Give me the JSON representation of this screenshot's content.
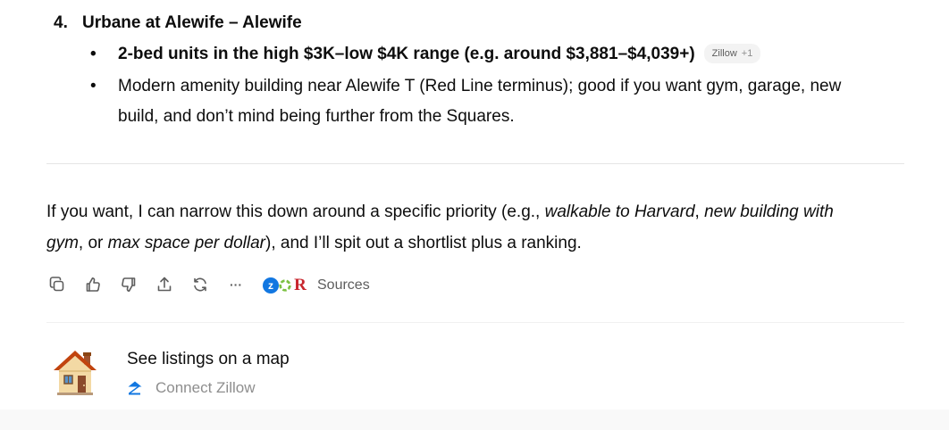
{
  "item": {
    "number": "4.",
    "title": "Urbane at Alewife – Alewife",
    "bullet_symbol": "•",
    "bullets": [
      {
        "text": "2-bed units in the high $3K–low $4K range (e.g. around $3,881–$4,039+)",
        "badge": {
          "label": "Zillow",
          "extra": "+1"
        }
      },
      {
        "line1": "Modern amenity building near Alewife T (Red Line terminus); good if you want gym, garage, new",
        "line2": "build, and don’t mind being further from the Squares."
      }
    ]
  },
  "paragraph": {
    "p1": "If you want, I can narrow this down around a specific priority (e.g., ",
    "em1": "walkable to Harvard",
    "p2": ", ",
    "em2": "new building with",
    "em3": "gym",
    "p3": ", or ",
    "em4": "max space per dollar",
    "p4": "), and I’ll spit out a shortlist plus a ranking."
  },
  "actions": {
    "icons": [
      "copy-icon",
      "thumbs-up-icon",
      "thumbs-down-icon",
      "share-icon",
      "regenerate-icon",
      "more-icon"
    ],
    "more_glyph": "···",
    "sources": {
      "label": "Sources",
      "z_glyph": "z",
      "r_glyph": "R"
    }
  },
  "map_card": {
    "title": "See listings on a map",
    "connect_label": "Connect Zillow"
  },
  "colors": {
    "zillow_blue": "#1277e1",
    "realtor_red": "#c8262e",
    "muted_text": "#5d5d5d",
    "light_text": "#8e8e8e"
  }
}
